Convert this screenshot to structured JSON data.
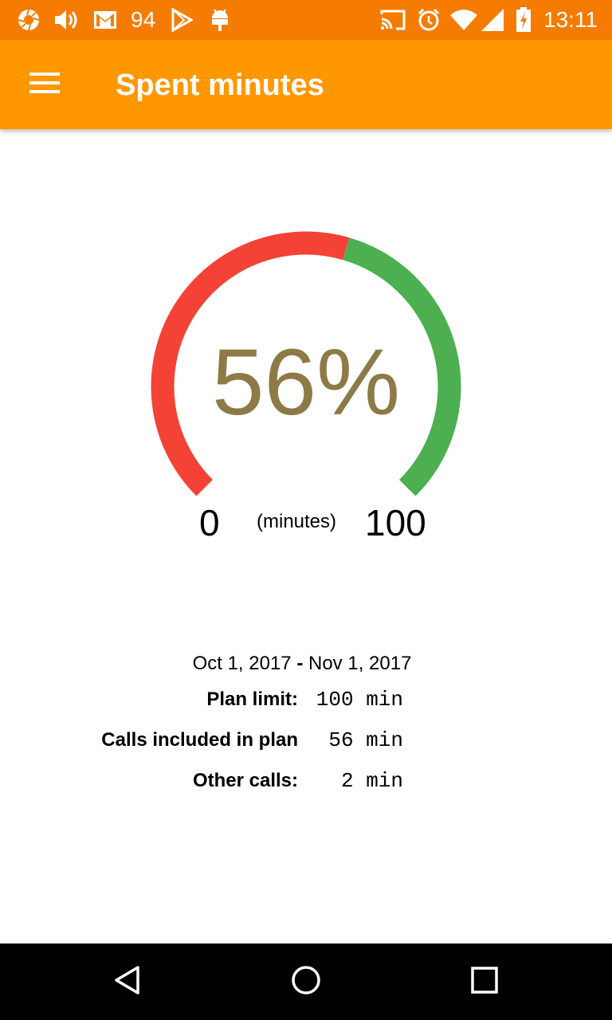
{
  "status_bar": {
    "notification_count": "94",
    "time": "13:11",
    "icons": [
      "shutter-icon",
      "volume-icon",
      "gmail-icon",
      "play-store-icon",
      "android-icon",
      "cast-icon",
      "alarm-icon",
      "wifi-icon",
      "signal-icon",
      "battery-charging-icon"
    ]
  },
  "app_bar": {
    "title": "Spent minutes",
    "menu_icon": "hamburger-menu-icon"
  },
  "gauge": {
    "percent": 56,
    "percent_text": "56%",
    "min_label": "0",
    "max_label": "100",
    "units_label": "(minutes)",
    "colors": {
      "used": "#f44336",
      "remaining": "#4caf50",
      "text": "#8d7a46"
    }
  },
  "summary": {
    "start_date": "Oct 1, 2017",
    "separator": "-",
    "end_date": "Nov 1, 2017",
    "rows": [
      {
        "label": "Plan limit:",
        "value": "100 min"
      },
      {
        "label": "Calls included in plan",
        "value": "56 min"
      },
      {
        "label": "Other calls:",
        "value": "2 min"
      }
    ]
  },
  "nav_bar": {
    "icons": [
      "back-icon",
      "home-icon",
      "recents-icon"
    ]
  },
  "theme": {
    "status_bar": "#f57c00",
    "app_bar": "#ff9800"
  }
}
